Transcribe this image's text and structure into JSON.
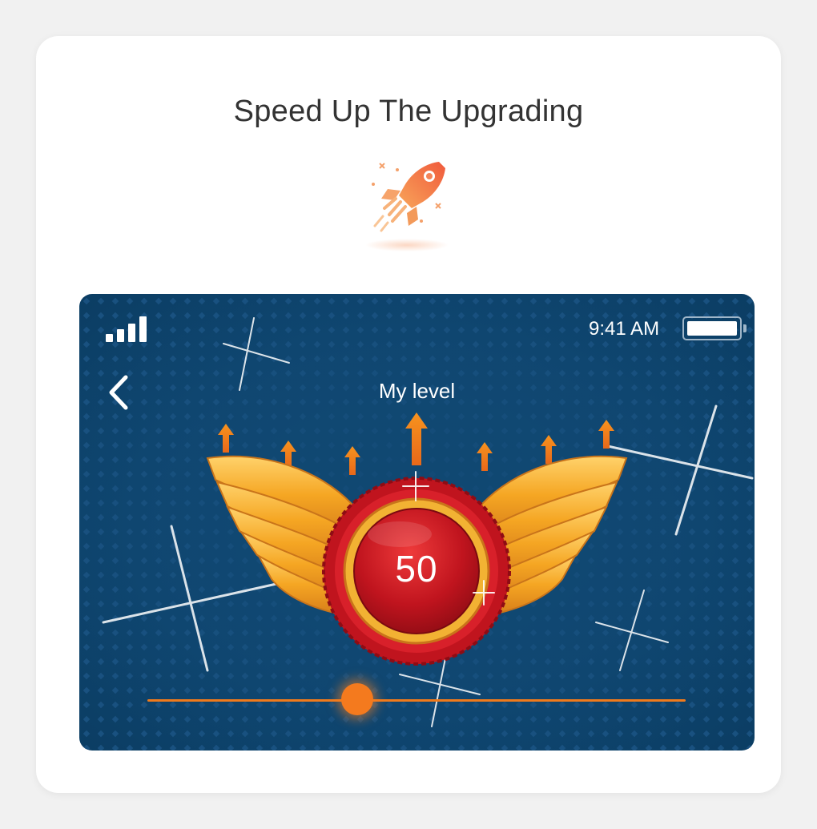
{
  "page": {
    "heading": "Speed Up The Upgrading",
    "icon": "rocket-icon"
  },
  "phone": {
    "status_bar": {
      "time": "9:41 AM",
      "signal_icon": "signal-bars-icon",
      "battery_icon": "battery-icon",
      "battery_level": 1.0
    },
    "header": {
      "back_icon": "chevron-left-icon",
      "title": "My level"
    },
    "level": {
      "value": "50",
      "badge_icon": "winged-badge-icon"
    },
    "progress": {
      "fraction": 0.39
    },
    "colors": {
      "background": "#0f4670",
      "accent": "#f47a1e",
      "gold": "#f5a623",
      "badge_red": "#c0141e"
    }
  }
}
